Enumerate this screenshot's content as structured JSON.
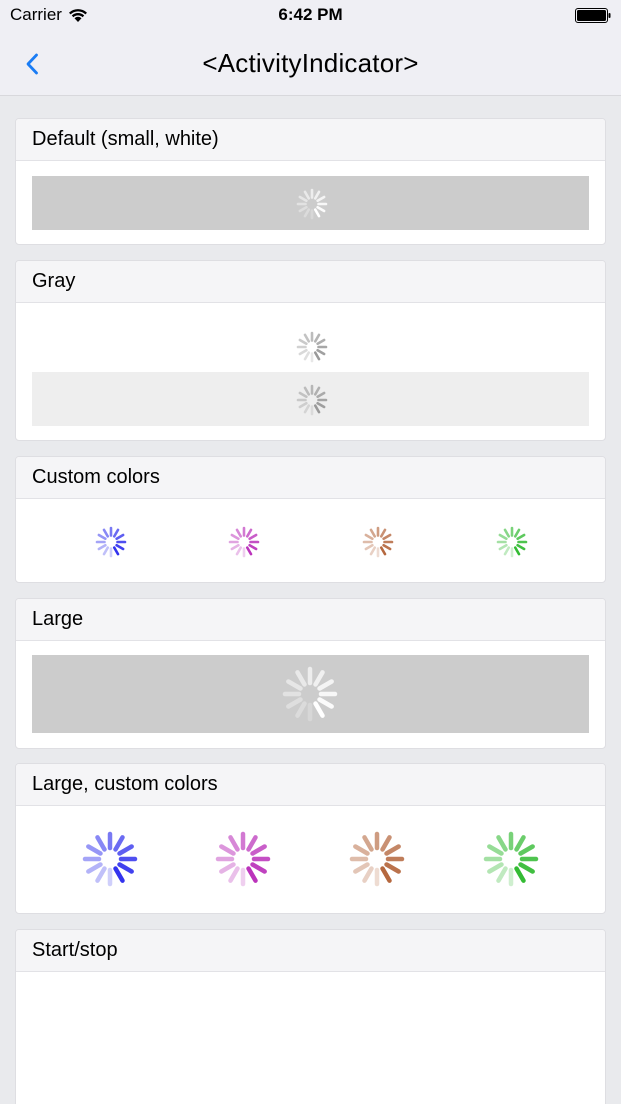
{
  "status_bar": {
    "carrier": "Carrier",
    "time": "6:42 PM"
  },
  "nav": {
    "title": "<ActivityIndicator>",
    "back_icon": "chevron-left-icon",
    "accent_color": "#1a7cf4"
  },
  "sections": [
    {
      "title": "Default (small, white)"
    },
    {
      "title": "Gray"
    },
    {
      "title": "Custom colors"
    },
    {
      "title": "Large"
    },
    {
      "title": "Large, custom colors"
    },
    {
      "title": "Start/stop"
    }
  ],
  "indicator_colors": {
    "white": "#ffffff",
    "gray": "#999999",
    "blue": "#3333ee",
    "purple": "#bb33bb",
    "brown": "#b5683f",
    "green": "#33bb33"
  },
  "backgrounds": {
    "dark_box": "#cccccc",
    "light_box": "#eeeeee"
  }
}
